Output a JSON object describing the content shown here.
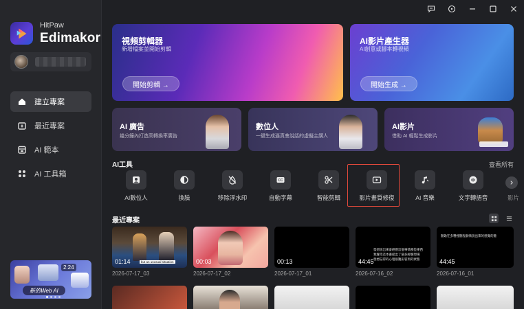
{
  "app": {
    "brand_small": "HitPaw",
    "brand_big": "Edimakor"
  },
  "sidebar": {
    "items": [
      {
        "label": "建立專案",
        "icon": "home-icon",
        "active": true
      },
      {
        "label": "最近專案",
        "icon": "recent-icon",
        "active": false
      },
      {
        "label": "AI 範本",
        "icon": "template-icon",
        "active": false
      },
      {
        "label": "AI 工具箱",
        "icon": "toolbox-icon",
        "active": false
      }
    ],
    "promo_label": "新的Web AI",
    "promo_time": "2:24"
  },
  "hero": [
    {
      "title": "視頻剪輯器",
      "subtitle": "新增檔案並開始剪輯",
      "button": "開始剪輯 →"
    },
    {
      "title": "AI影片產生器",
      "subtitle": "AI創意或腳本轉視頻",
      "button": "開始生成 →"
    }
  ],
  "features": [
    {
      "title": "AI 廣告",
      "subtitle": "幾分鐘內打造高轉換率廣告"
    },
    {
      "title": "數位人",
      "subtitle": "一鍵生成逼真會說話的虛擬主講人"
    },
    {
      "title": "AI影片",
      "subtitle": "借助 AI 輕鬆生成影片"
    }
  ],
  "ai_tools": {
    "header": "AI工具",
    "view_all": "查看所有",
    "items": [
      {
        "label": "AI數位人",
        "icon": "avatar-icon"
      },
      {
        "label": "換臉",
        "icon": "face-swap-icon"
      },
      {
        "label": "移除浮水印",
        "icon": "watermark-remove-icon"
      },
      {
        "label": "自動字幕",
        "icon": "cc-icon"
      },
      {
        "label": "智能剪輯",
        "icon": "smart-cut-icon"
      },
      {
        "label": "影片畫質修復",
        "icon": "video-enhance-icon"
      },
      {
        "label": "AI 音樂",
        "icon": "music-icon"
      },
      {
        "label": "文字轉語音",
        "icon": "tts-icon"
      },
      {
        "label": "影片",
        "icon": "video-icon"
      }
    ]
  },
  "recent": {
    "header": "最近專案",
    "projects": [
      {
        "duration": "01:14",
        "date": "2026-07-17_03"
      },
      {
        "duration": "00:03",
        "date": "2026-07-17_02"
      },
      {
        "duration": "00:13",
        "date": "2026-07-17_01"
      },
      {
        "duration": "44:45",
        "date": "2026-07-16_02"
      },
      {
        "duration": "44:45",
        "date": "2026-07-16_01"
      }
    ],
    "thumb1_caption": "but an unusual situation",
    "thumb4_lines": [
      "發想說出來會經歷這個事情那些東西",
      "我覺得這本書提出了蠻多經驗現場",
      "發想記得的心理很難形容到的狀態"
    ],
    "thumb5_line": "聽歌在多種裡聽程劇情說出來的感覺的聽"
  },
  "colors": {
    "accent_red": "#e0483b",
    "bg": "#1f2024",
    "sidebar_bg": "#26272b"
  }
}
